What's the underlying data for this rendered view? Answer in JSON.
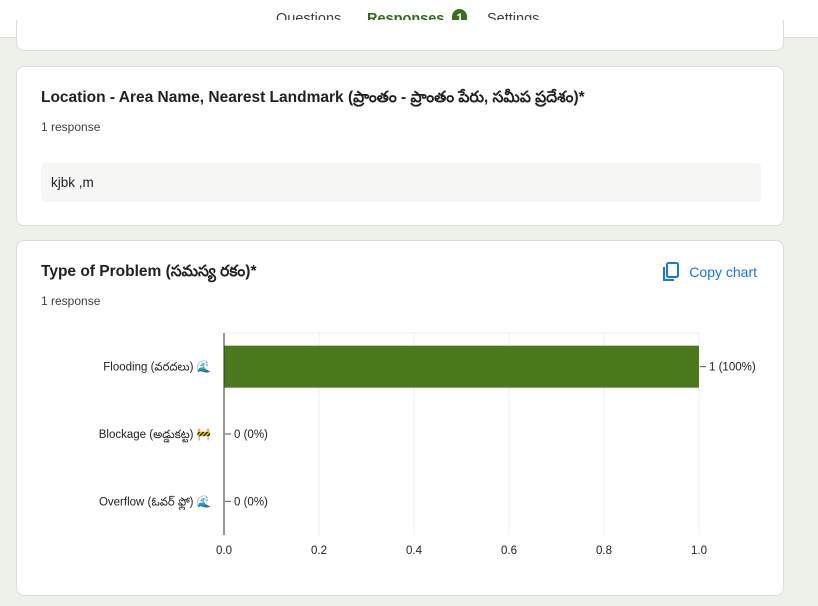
{
  "tabs": [
    {
      "label": "Questions",
      "active": false
    },
    {
      "label": "Responses",
      "active": true,
      "badge": "1"
    },
    {
      "label": "Settings",
      "active": false
    }
  ],
  "location_question": {
    "title": "Location - Area Name, Nearest Landmark (ప్రాంతం - ప్రాంతం పేరు, సమీప ప్రదేశం)*",
    "response_count": "1 response",
    "answers": [
      "kjbk ,m"
    ]
  },
  "type_question": {
    "title": "Type of Problem (సమస్య రకం)*",
    "response_count": "1 response",
    "copy_label": "Copy chart"
  },
  "colors": {
    "accent": "#3a6f1d",
    "bar": "#4a7a1c",
    "link": "#1a73e8"
  },
  "chart_data": {
    "type": "bar",
    "orientation": "horizontal",
    "categories": [
      "Flooding (వరదలు) 🌊",
      "Blockage (అడ్డుకట్ట) 🚧",
      "Overflow (ఓవర్ ఫ్లో) 🌊"
    ],
    "values": [
      1,
      0,
      0
    ],
    "value_labels": [
      "1 (100%)",
      "0 (0%)",
      "0 (0%)"
    ],
    "xlim": [
      0,
      1.0
    ],
    "xticks": [
      "0.0",
      "0.2",
      "0.4",
      "0.6",
      "0.8",
      "1.0"
    ],
    "grid": true
  }
}
